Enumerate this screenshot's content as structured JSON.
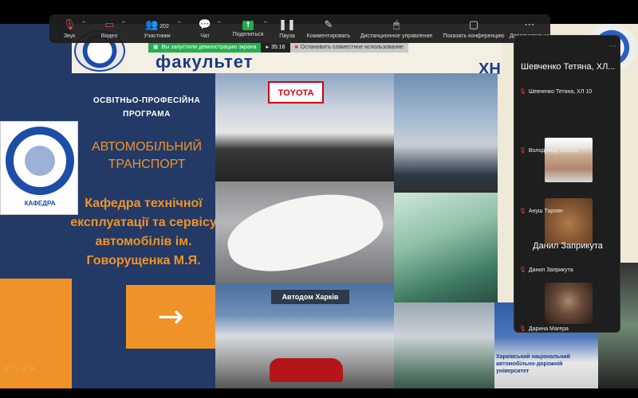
{
  "toolbar": {
    "items": [
      {
        "label": "Звук",
        "icon": "mic-muted-icon"
      },
      {
        "label": "Видео",
        "icon": "video-muted-icon"
      },
      {
        "label": "Участники",
        "icon": "participants-icon",
        "count": "202"
      },
      {
        "label": "Чат",
        "icon": "chat-icon"
      },
      {
        "label": "Поделиться",
        "icon": "share-screen-icon"
      },
      {
        "label": "Пауза",
        "icon": "pause-icon"
      },
      {
        "label": "Комментировать",
        "icon": "annotate-icon"
      },
      {
        "label": "Дистанционное управление",
        "icon": "remote-control-icon"
      },
      {
        "label": "Показать конференцию",
        "icon": "show-meeting-icon"
      },
      {
        "label": "Дополнительно",
        "icon": "more-icon"
      }
    ]
  },
  "share_bar": {
    "notice": "Вы запустили демонстрацию экрана",
    "timer": "35:16",
    "stop": "Остановить совместное использование"
  },
  "slide": {
    "faculty": "факультет",
    "kh": "ХН",
    "dept_logo_label": "КАФЕДРА",
    "program_label": "ОСВІТНЬО-ПРОФЕСІЙНА ПРОГРАМА",
    "program_name": "АВТОМОБІЛЬНИЙ ТРАНСПОРТ",
    "department": "Кафедра технічної експлуатації та сервісу автомобілів ім. Говорущенка М.Я.",
    "arrow": "→",
    "toyota_sign": "TOYOTA",
    "dealer_sign": "Автодом Харків",
    "uni_caption": "Харківський національний автомобільно-дорожній університет"
  },
  "participants": {
    "header": "Шевченко Тетяна, ХЛ...",
    "tiles": [
      {
        "name": "Шевченко Тетяна, ХЛ 10"
      },
      {
        "name": "Володимир Волков"
      },
      {
        "name": "Ануш Тароян"
      },
      {
        "name": "Данил Заприкута"
      },
      {
        "name": "Дарина Магера"
      }
    ],
    "big_name": "Данил Заприкута"
  },
  "slide_nav": [
    "◀",
    "✎",
    "▣",
    "▶"
  ],
  "colors": {
    "slide_blue": "#233a66",
    "slide_orange": "#ef9328",
    "share_green": "#24b04f",
    "muted_red": "#e04646"
  }
}
